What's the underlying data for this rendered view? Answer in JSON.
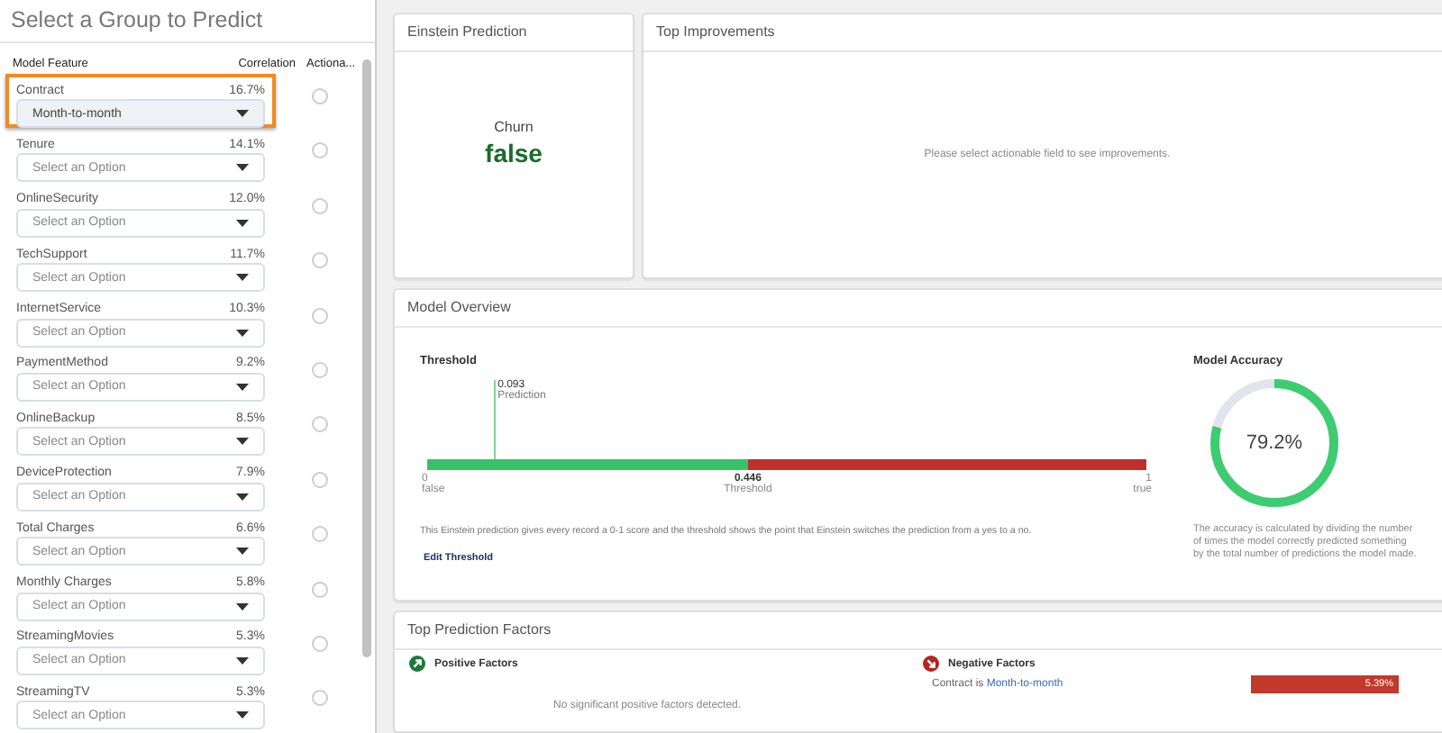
{
  "left_panel": {
    "title": "Select a Group to Predict",
    "columns": [
      "Model Feature",
      "Correlation",
      "Actiona..."
    ],
    "features": [
      {
        "name": "Contract",
        "correlation": "16.7%",
        "value": "Month-to-month",
        "highlighted": true,
        "selected": false
      },
      {
        "name": "Tenure",
        "correlation": "14.1%",
        "placeholder": "Select an Option",
        "highlighted": false,
        "selected": false
      },
      {
        "name": "OnlineSecurity",
        "correlation": "12.0%",
        "placeholder": "Select an Option",
        "highlighted": false,
        "selected": false
      },
      {
        "name": "TechSupport",
        "correlation": "11.7%",
        "placeholder": "Select an Option",
        "highlighted": false,
        "selected": false
      },
      {
        "name": "InternetService",
        "correlation": "10.3%",
        "placeholder": "Select an Option",
        "highlighted": false,
        "selected": false
      },
      {
        "name": "PaymentMethod",
        "correlation": "9.2%",
        "placeholder": "Select an Option",
        "highlighted": false,
        "selected": false
      },
      {
        "name": "OnlineBackup",
        "correlation": "8.5%",
        "placeholder": "Select an Option",
        "highlighted": false,
        "selected": false
      },
      {
        "name": "DeviceProtection",
        "correlation": "7.9%",
        "placeholder": "Select an Option",
        "highlighted": false,
        "selected": false
      },
      {
        "name": "Total Charges",
        "correlation": "6.6%",
        "placeholder": "Select an Option",
        "highlighted": false,
        "selected": false
      },
      {
        "name": "Monthly Charges",
        "correlation": "5.8%",
        "placeholder": "Select an Option",
        "highlighted": false,
        "selected": false
      },
      {
        "name": "StreamingMovies",
        "correlation": "5.3%",
        "placeholder": "Select an Option",
        "highlighted": false,
        "selected": false
      },
      {
        "name": "StreamingTV",
        "correlation": "5.3%",
        "placeholder": "Select an Option",
        "highlighted": false,
        "selected": false
      }
    ]
  },
  "prediction": {
    "title": "Einstein Prediction",
    "label": "Churn",
    "value": "false"
  },
  "improvements": {
    "title": "Top Improvements",
    "message": "Please select actionable field to see improvements."
  },
  "model_overview": {
    "title": "Model Overview",
    "threshold": {
      "title": "Threshold",
      "prediction": {
        "value": "0.093",
        "label": "Prediction",
        "level": 0.093
      },
      "threshold": {
        "value": "0.446",
        "label": "Threshold",
        "level": 0.446
      },
      "min": {
        "value": "0",
        "label": "false"
      },
      "max": {
        "value": "1",
        "label": "true"
      },
      "description": "This Einstein prediction gives every record a 0-1 score and the threshold shows the point that Einstein switches the prediction from a yes to a no.",
      "link": "Edit Threshold"
    },
    "accuracy": {
      "title": "Model Accuracy",
      "reading": "79.2%",
      "level": 0.792,
      "description": "The accuracy is calculated by dividing the number of times the model correctly predicted something by the total number of predictions the model made."
    }
  },
  "factors": {
    "title": "Top Prediction Factors",
    "positive": {
      "title": "Positive Factors",
      "message": "No significant positive factors detected."
    },
    "negative": {
      "title": "Negative Factors",
      "items": [
        {
          "field": "Contract is",
          "value": "Month-to-month",
          "reading": "5.39%"
        }
      ]
    }
  }
}
